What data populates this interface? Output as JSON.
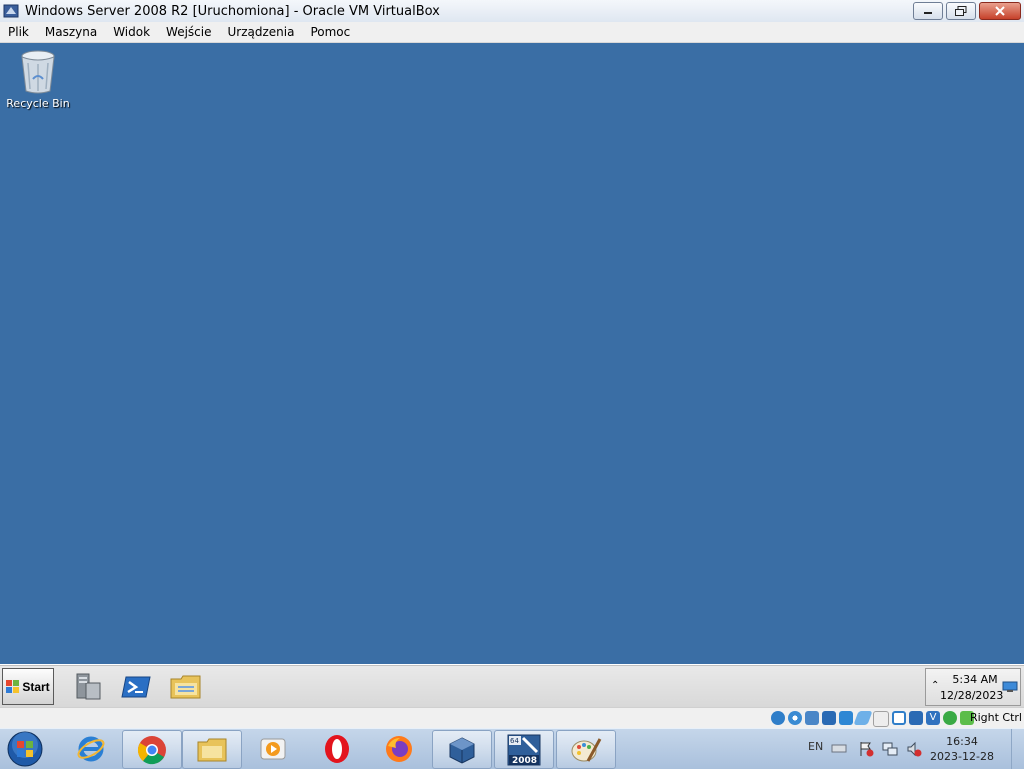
{
  "window": {
    "title": "Windows Server 2008 R2 [Uruchomiona] - Oracle VM VirtualBox",
    "icon": "virtualbox-icon",
    "controls": [
      "minimize-icon",
      "restore-icon",
      "close-icon"
    ]
  },
  "menubar": {
    "items": [
      {
        "label": "Plik"
      },
      {
        "label": "Maszyna"
      },
      {
        "label": "Widok"
      },
      {
        "label": "Wejście"
      },
      {
        "label": "Urządzenia"
      },
      {
        "label": "Pomoc"
      }
    ]
  },
  "desktop": {
    "background": "#3a6ea5",
    "icons": [
      {
        "label": "Recycle Bin",
        "icon": "recycle-bin-icon"
      }
    ]
  },
  "guest_taskbar": {
    "start_label": "Start",
    "quick_launch": [
      "server-manager-icon",
      "powershell-icon",
      "explorer-folder-icon"
    ],
    "time": "5:34 AM",
    "date": "12/28/2023"
  },
  "vbox_status": {
    "icons": [
      "hard-disk-icon",
      "optical-drive-icon",
      "audio-icon",
      "network-icon",
      "usb-icon",
      "shared-folders-icon",
      "display-icon",
      "video-capture-icon",
      "cpu-icon",
      "mouse-integration-icon",
      "guest-additions-icon"
    ],
    "host_key": "Right Ctrl"
  },
  "host_taskbar": {
    "apps": [
      "internet-explorer-icon",
      "chrome-icon",
      "explorer-icon",
      "media-player-icon",
      "opera-icon",
      "firefox-icon",
      "virtualbox-icon",
      "windows-server-2008-icon",
      "paint-icon"
    ],
    "vm_badge_top": "64",
    "vm_badge_bottom": "2008",
    "language": "EN",
    "time": "16:34",
    "date": "2023-12-28"
  }
}
